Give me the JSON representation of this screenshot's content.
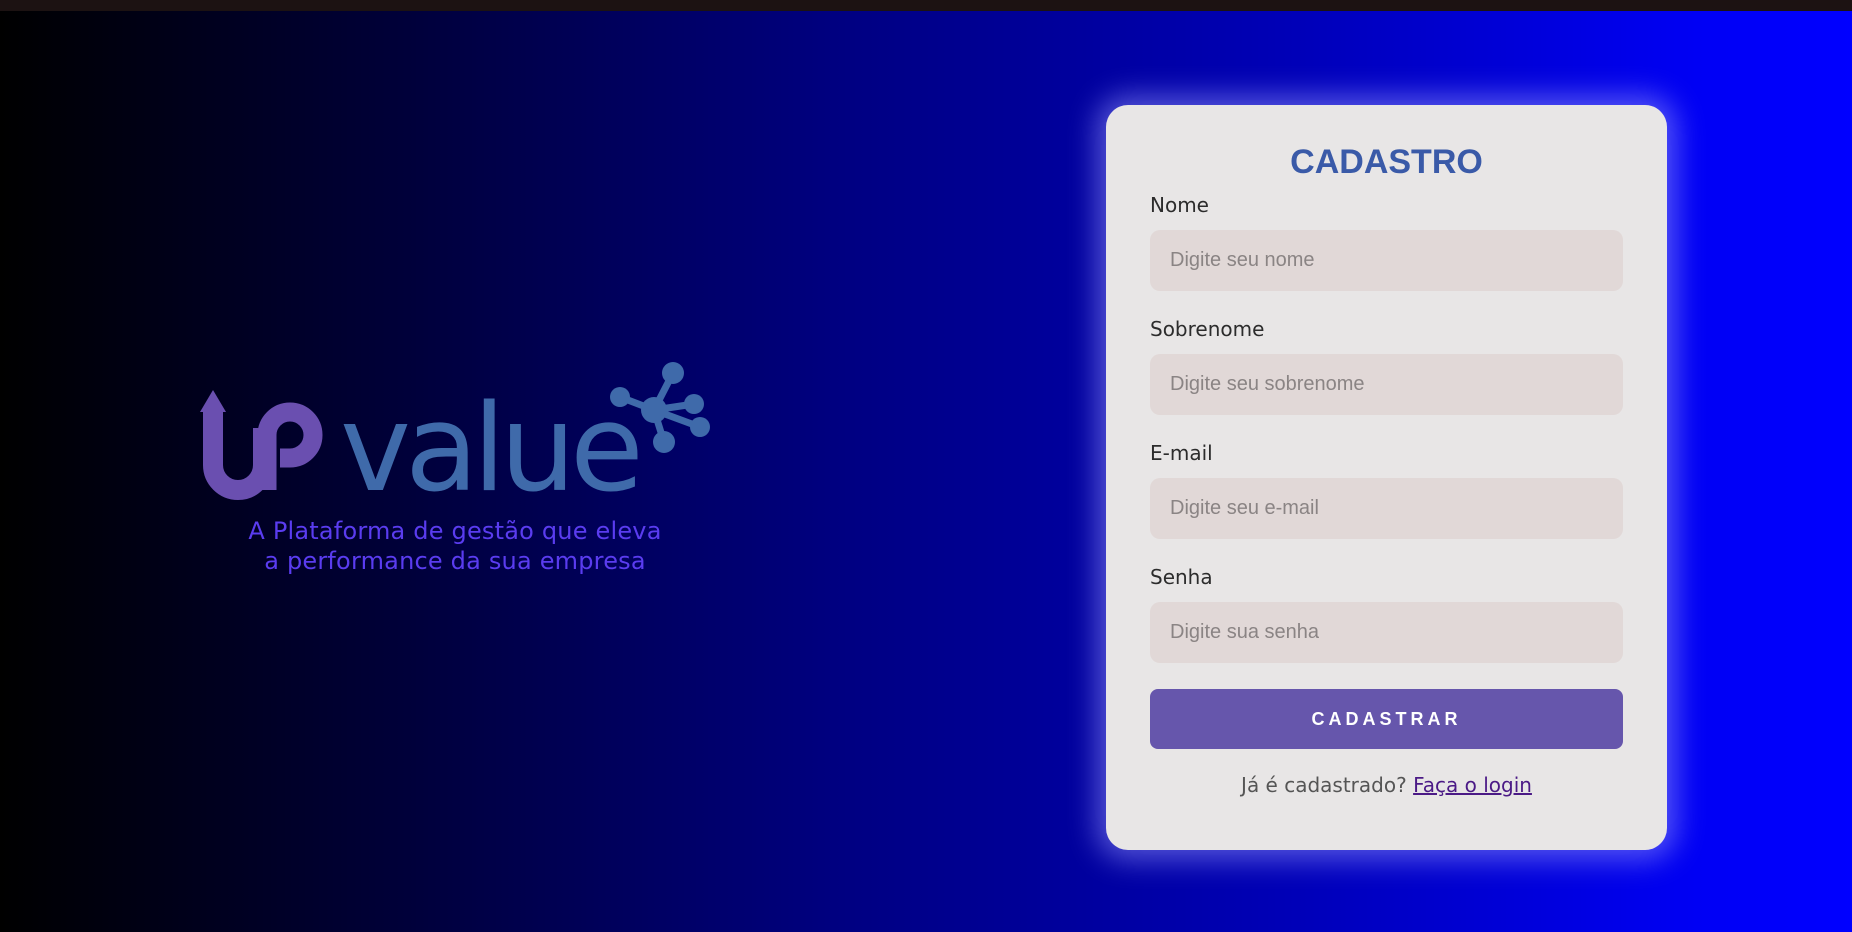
{
  "brand": {
    "logo_text": "UPvalue",
    "tagline_line1": "A Plataforma de gestão que eleva",
    "tagline_line2": "a performance da sua empresa"
  },
  "form": {
    "title": "CADASTRO",
    "fields": [
      {
        "label": "Nome",
        "placeholder": "Digite seu nome"
      },
      {
        "label": "Sobrenome",
        "placeholder": "Digite seu sobrenome"
      },
      {
        "label": "E-mail",
        "placeholder": "Digite seu e-mail"
      },
      {
        "label": "Senha",
        "placeholder": "Digite sua senha"
      }
    ],
    "submit_label": "CADASTRAR",
    "login_prompt": "Já é cadastrado?",
    "login_link": "Faça o login"
  },
  "colors": {
    "title": "#3a5aa8",
    "button": "#6656ac",
    "input_bg": "#e1d8d7",
    "card_bg": "#e8e6e6",
    "logo_up": "#6a4fb0",
    "logo_value": "#3f6aaa",
    "tagline": "#5a3cf0"
  }
}
